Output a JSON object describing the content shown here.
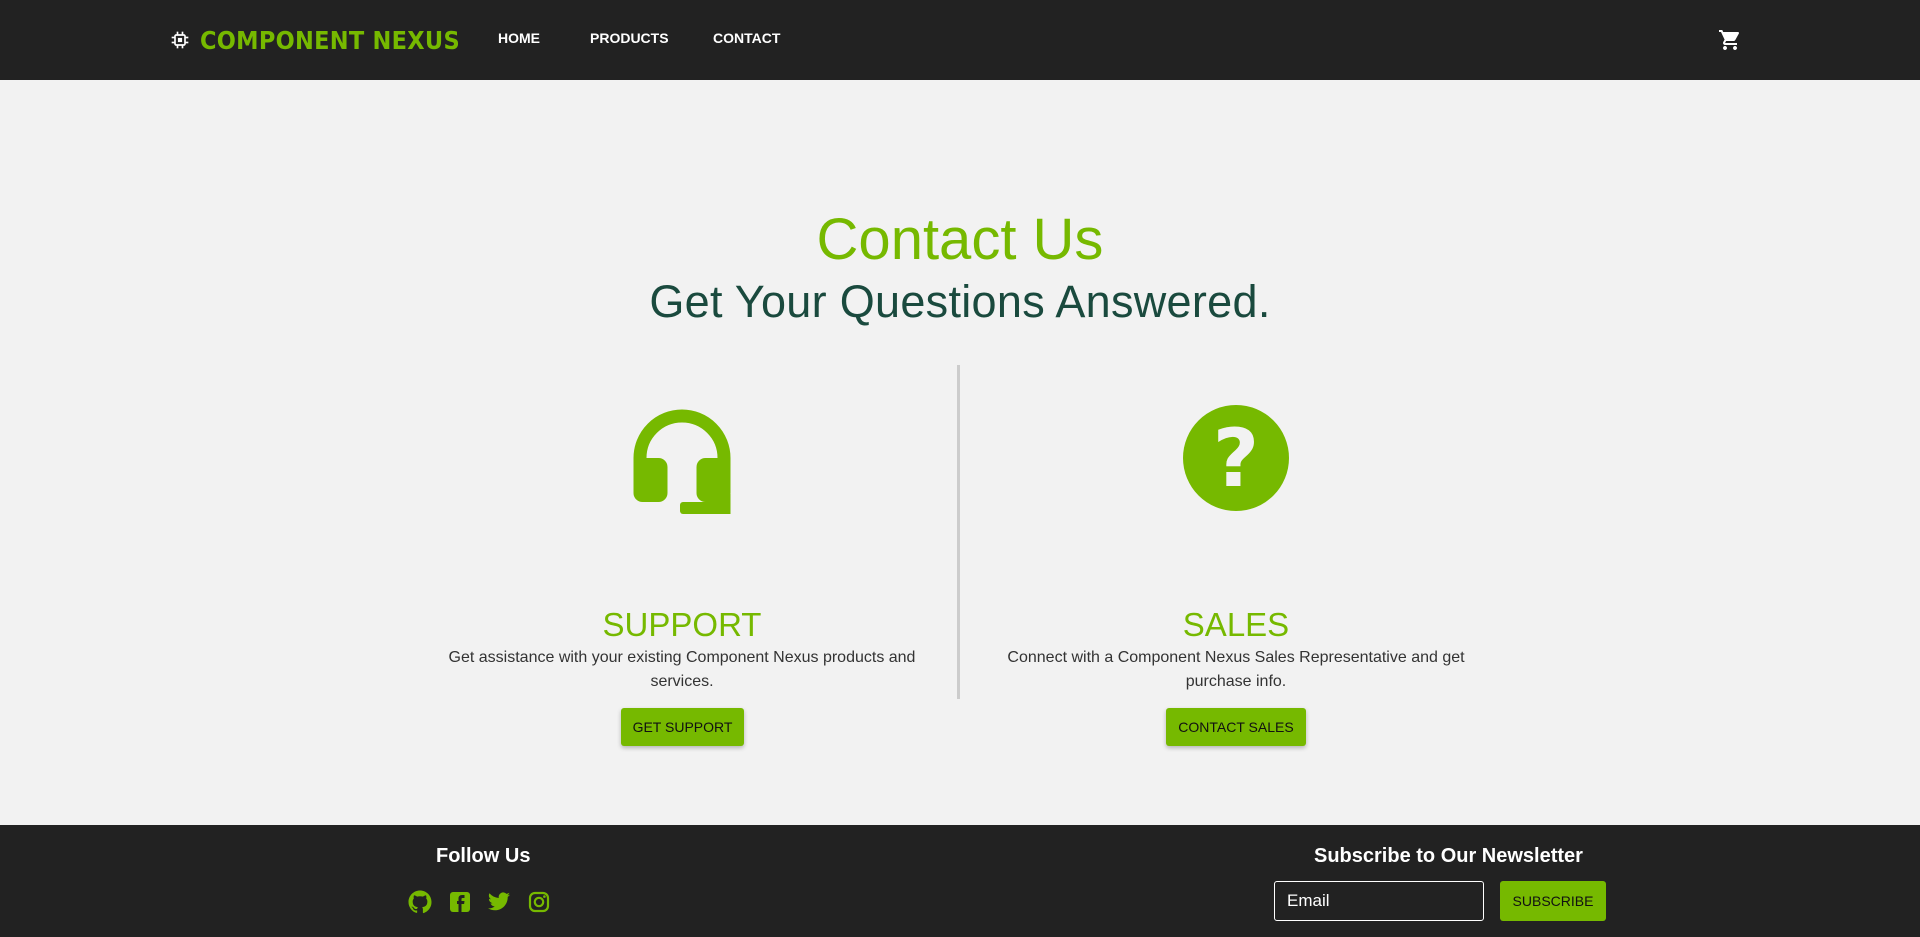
{
  "brand": {
    "name": "COMPONENT NEXUS",
    "icon": "chip-icon",
    "color": "#76b900"
  },
  "nav": {
    "items": [
      {
        "label": "HOME"
      },
      {
        "label": "PRODUCTS"
      },
      {
        "label": "CONTACT"
      }
    ],
    "cart_icon": "shopping-cart-icon"
  },
  "hero": {
    "title": "Contact Us",
    "subtitle": "Get Your Questions Answered."
  },
  "cards": [
    {
      "icon": "headset-icon",
      "title": "SUPPORT",
      "text": "Get assistance with your existing Component Nexus products and services.",
      "button": "GET SUPPORT"
    },
    {
      "icon": "question-circle-icon",
      "title": "SALES",
      "text": "Connect with a Component Nexus Sales Representative and get purchase info.",
      "button": "CONTACT SALES"
    }
  ],
  "footer": {
    "follow_heading": "Follow Us",
    "social_icons": [
      "github-icon",
      "facebook-icon",
      "twitter-icon",
      "instagram-icon"
    ],
    "newsletter_heading": "Subscribe to Our Newsletter",
    "email_placeholder": "Email",
    "subscribe_label": "SUBSCRIBE"
  },
  "colors": {
    "accent": "#76b900",
    "header_bg": "#222222",
    "page_bg": "#f2f2f2",
    "subtitle": "#1a4a3e"
  }
}
